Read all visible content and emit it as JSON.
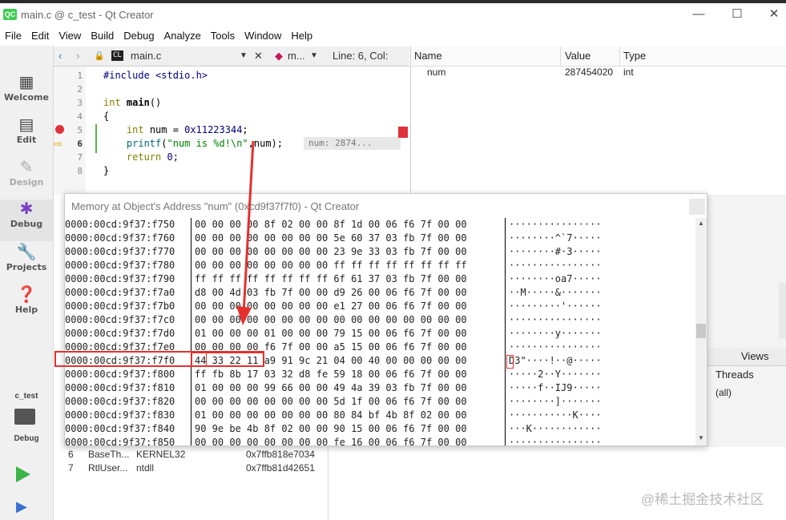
{
  "window": {
    "app_badge": "QC",
    "title": "main.c @ c_test - Qt Creator",
    "minimize": "—",
    "maximize": "☐",
    "close": "✕"
  },
  "menu": [
    "File",
    "Edit",
    "View",
    "Build",
    "Debug",
    "Analyze",
    "Tools",
    "Window",
    "Help"
  ],
  "sidebar": {
    "modes": [
      {
        "label": "Welcome",
        "icon": "grid-icon"
      },
      {
        "label": "Edit",
        "icon": "document-icon"
      },
      {
        "label": "Design",
        "icon": "pencil-icon"
      },
      {
        "label": "Debug",
        "icon": "bug-icon"
      },
      {
        "label": "Projects",
        "icon": "wrench-icon"
      },
      {
        "label": "Help",
        "icon": "question-icon"
      }
    ],
    "kit_name": "c_test",
    "kit_mode": "Debug"
  },
  "editor_toolbar": {
    "file_badge": "CL",
    "file_name": "main.c",
    "function_combo": "m...",
    "position": "Line: 6, Col:"
  },
  "editor": {
    "line_numbers": [
      "1",
      "2",
      "3",
      "4",
      "5",
      "6",
      "7",
      "8"
    ],
    "lines": {
      "l1": "#include <stdio.h>",
      "l3_kw": "int",
      "l3_fn": "main",
      "l3_rest": "()",
      "l4": "{",
      "l5_kw": "int",
      "l5_mid": " num = ",
      "l5_num": "0x11223344",
      "l5_end": ";",
      "l6_fn": "printf",
      "l6_open": "(",
      "l6_str": "\"num is %d!\\n\"",
      "l6_rest": ",num);",
      "l7_kw": "return",
      "l7_mid": " ",
      "l7_num": "0",
      "l7_end": ";",
      "l8": "}"
    },
    "inline_value": "num: 2874..."
  },
  "locals": {
    "headers": [
      "Name",
      "Value",
      "Type"
    ],
    "row": {
      "name": "num",
      "value": "287454020",
      "type": "int"
    }
  },
  "memory_view": {
    "title": "Memory at Object's Address \"num\" (0xcd9f37f7f0) - Qt Creator",
    "rows": [
      {
        "addr": "0000:00cd:9f37:f750",
        "hex": "00 00 00 00 8f 02 00 00 8f 1d 00 06 f6 7f 00 00",
        "ascii": "················"
      },
      {
        "addr": "0000:00cd:9f37:f760",
        "hex": "00 00 00 00 00 00 00 00 5e 60 37 03 fb 7f 00 00",
        "ascii": "········^`7·····"
      },
      {
        "addr": "0000:00cd:9f37:f770",
        "hex": "00 00 00 00 00 00 00 00 23 9e 33 03 fb 7f 00 00",
        "ascii": "········#·3·····"
      },
      {
        "addr": "0000:00cd:9f37:f780",
        "hex": "00 00 00 00 00 00 00 00 ff ff ff ff ff ff ff ff",
        "ascii": "················"
      },
      {
        "addr": "0000:00cd:9f37:f790",
        "hex": "ff ff ff ff ff ff ff ff 6f 61 37 03 fb 7f 00 00",
        "ascii": "········oa7·····"
      },
      {
        "addr": "0000:00cd:9f37:f7a0",
        "hex": "d8 00 4d 03 fb 7f 00 00 d9 26 00 06 f6 7f 00 00",
        "ascii": "··M·····&·······"
      },
      {
        "addr": "0000:00cd:9f37:f7b0",
        "hex": "00 00 00 00 00 00 00 00 e1 27 00 06 f6 7f 00 00",
        "ascii": "·········'······"
      },
      {
        "addr": "0000:00cd:9f37:f7c0",
        "hex": "00 00 00 00 00 00 00 00 00 00 00 00 00 00 00 00",
        "ascii": "················"
      },
      {
        "addr": "0000:00cd:9f37:f7d0",
        "hex": "01 00 00 00 01 00 00 00 79 15 00 06 f6 7f 00 00",
        "ascii": "········y·······"
      },
      {
        "addr": "0000:00cd:9f37:f7e0",
        "hex": "00 00 00 00 f6 7f 00 00 a5 15 00 06 f6 7f 00 00",
        "ascii": "················"
      },
      {
        "addr": "0000:00cd:9f37:f7f0",
        "hex": "44 33 22 11 a9 91 9c 21 04 00 40 00 00 00 00 00",
        "ascii": "D3\"····!··@·····"
      },
      {
        "addr": "0000:00cd:9f37:f800",
        "hex": "ff fb 8b 17 03 32 d8 fe 59 18 00 06 f6 7f 00 00",
        "ascii": "·····2··Y·······"
      },
      {
        "addr": "0000:00cd:9f37:f810",
        "hex": "01 00 00 00 99 66 00 00 49 4a 39 03 fb 7f 00 00",
        "ascii": "·····f··IJ9·····"
      },
      {
        "addr": "0000:00cd:9f37:f820",
        "hex": "00 00 00 00 00 00 00 00 5d 1f 00 06 f6 7f 00 00",
        "ascii": "········]·······"
      },
      {
        "addr": "0000:00cd:9f37:f830",
        "hex": "01 00 00 00 00 00 00 00 80 84 bf 4b 8f 02 00 00",
        "ascii": "···········K····"
      },
      {
        "addr": "0000:00cd:9f37:f840",
        "hex": "90 9e be 4b 8f 02 00 00 90 15 00 06 f6 7f 00 00",
        "ascii": "···K············"
      },
      {
        "addr": "0000:00cd:9f37:f850",
        "hex": "00 00 00 00 00 00 00 00 fe 16 00 06 f6 7f 00 00",
        "ascii": "················"
      }
    ]
  },
  "lower_right": {
    "views_label": "Views",
    "threads_label": "Threads",
    "threads_value": "(all)"
  },
  "stack": [
    {
      "level": "6",
      "function": "BaseTh...",
      "file": "KERNEL32",
      "address": "0x7ffb818e7034"
    },
    {
      "level": "7",
      "function": "RtlUser...",
      "file": "ntdll",
      "address": "0x7ffb81d42651"
    }
  ],
  "watermark": "@稀土掘金技术社区",
  "colors": {
    "highlight": "#e5302e",
    "accent_qt": "#41cd52"
  }
}
